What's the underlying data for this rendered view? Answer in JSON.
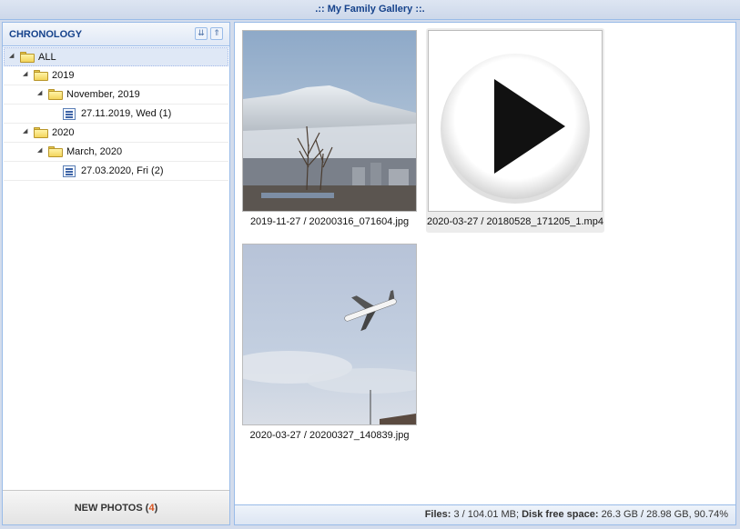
{
  "app": {
    "title": ".:: My Family Gallery ::."
  },
  "sidebar": {
    "title": "CHRONOLOGY",
    "tree": [
      {
        "label": "ALL",
        "level": 0,
        "type": "folder",
        "selected": true
      },
      {
        "label": "2019",
        "level": 1,
        "type": "folder"
      },
      {
        "label": "November, 2019",
        "level": 2,
        "type": "folder"
      },
      {
        "label": "27.11.2019, Wed (1)",
        "level": 3,
        "type": "day"
      },
      {
        "label": "2020",
        "level": 1,
        "type": "folder"
      },
      {
        "label": "March, 2020",
        "level": 2,
        "type": "folder"
      },
      {
        "label": "27.03.2020, Fri (2)",
        "level": 3,
        "type": "day"
      }
    ],
    "footer": {
      "label": "NEW PHOTOS",
      "open": "(",
      "count": "4",
      "close": ")"
    }
  },
  "gallery": {
    "items": [
      {
        "caption": "2019-11-27 / 20200316_071604.jpg",
        "kind": "photo-mountain"
      },
      {
        "caption": "2020-03-27 / 20180528_171205_1.mp4",
        "kind": "video-play-icon"
      },
      {
        "caption": "2020-03-27 / 20200327_140839.jpg",
        "kind": "photo-airplane"
      }
    ]
  },
  "status": {
    "files_label": "Files:",
    "files_value": "3 / 104.01 MB;",
    "disk_label": "Disk free space:",
    "disk_value": "26.3 GB / 28.98 GB, 90.74%"
  }
}
